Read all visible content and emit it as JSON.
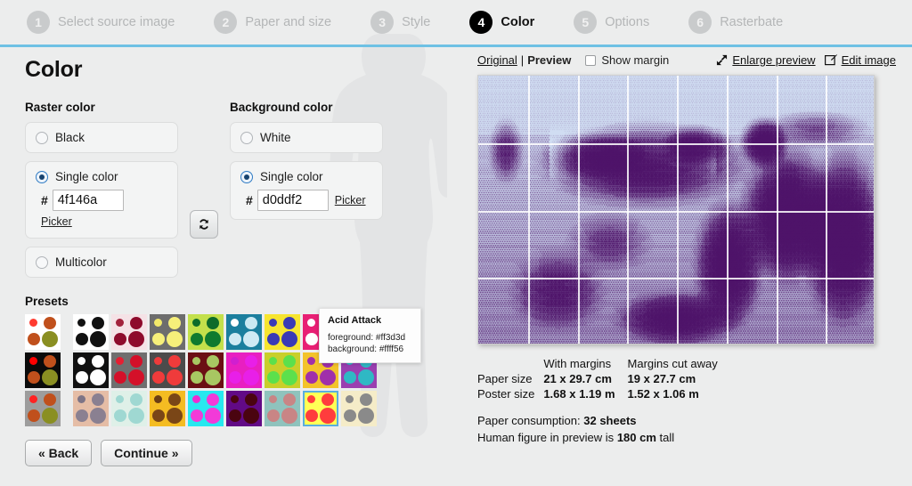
{
  "stepper": {
    "steps": [
      {
        "num": "1",
        "label": "Select source image",
        "active": false
      },
      {
        "num": "2",
        "label": "Paper and size",
        "active": false
      },
      {
        "num": "3",
        "label": "Style",
        "active": false
      },
      {
        "num": "4",
        "label": "Color",
        "active": true
      },
      {
        "num": "5",
        "label": "Options",
        "active": false
      },
      {
        "num": "6",
        "label": "Rasterbate",
        "active": false
      }
    ]
  },
  "page": {
    "title": "Color"
  },
  "raster_color": {
    "group_label": "Raster color",
    "black_label": "Black",
    "black_selected": false,
    "single_label": "Single color",
    "single_selected": true,
    "hash": "#",
    "hex_value": "4f146a",
    "picker_label": "Picker",
    "multicolor_label": "Multicolor",
    "multicolor_selected": false
  },
  "background_color": {
    "group_label": "Background color",
    "white_label": "White",
    "white_selected": false,
    "single_label": "Single color",
    "single_selected": true,
    "hash": "#",
    "hex_value": "d0ddf2",
    "picker_label": "Picker"
  },
  "swap_button": {
    "icon": "swap-colors-icon"
  },
  "presets": {
    "title": "Presets",
    "first_column": [
      {
        "bg": "#ffffff",
        "c1": "#ff3b30",
        "c2": "#c0501c",
        "c3": "#c0501c",
        "c4": "#8a8f22"
      },
      {
        "bg": "#0b0b0b",
        "c1": "#ff0000",
        "c2": "#c0501c",
        "c3": "#c0501c",
        "c4": "#8a8f22"
      },
      {
        "bg": "#9d9d9d",
        "c1": "#ff2222",
        "c2": "#c0501c",
        "c3": "#c0501c",
        "c4": "#8a8f22"
      }
    ],
    "grid": [
      [
        {
          "bg": "#ffffff",
          "c1": "#111111",
          "c2": "#111111",
          "c3": "#111111",
          "c4": "#111111"
        },
        {
          "bg": "#f5e2e6",
          "c1": "#a3223c",
          "c2": "#8e0b2c",
          "c3": "#8e0b2c",
          "c4": "#8e0b2c"
        },
        {
          "bg": "#6d6d6d",
          "c1": "#f2e96a",
          "c2": "#f6ef7a",
          "c3": "#f6ef7a",
          "c4": "#f6ef7a"
        },
        {
          "bg": "#c3e04b",
          "c1": "#0d6b2a",
          "c2": "#0d6b2a",
          "c3": "#0f7a2f",
          "c4": "#0f7a2f"
        },
        {
          "bg": "#1b7f9e",
          "c1": "#ffffff",
          "c2": "#c9e9f3",
          "c3": "#cfeaf4",
          "c4": "#cfeaf4"
        },
        {
          "bg": "#f7e52f",
          "c1": "#3a3ab5",
          "c2": "#3a3ab5",
          "c3": "#3a3ab5",
          "c4": "#3a3ab5"
        },
        {
          "bg": "#e81f74",
          "c1": "#ffffff",
          "c2": "#ffffff",
          "c3": "#ffffff",
          "c4": "#ffffff"
        },
        {
          "bg": "#cdd6ee",
          "c1": "#6a3f9e",
          "c2": "#6a2f9e",
          "c3": "#6a2f9e",
          "c4": "#6a2f9e"
        }
      ],
      [
        {
          "bg": "#111111",
          "c1": "#ffffff",
          "c2": "#ffffff",
          "c3": "#ffffff",
          "c4": "#ffffff"
        },
        {
          "bg": "#6f6f6f",
          "c1": "#e51f32",
          "c2": "#d41029",
          "c3": "#d41029",
          "c4": "#d41029"
        },
        {
          "bg": "#4b4b4b",
          "c1": "#ef3b3b",
          "c2": "#ef3b3b",
          "c3": "#ef3b3b",
          "c4": "#ef3b3b"
        },
        {
          "bg": "#6b0f14",
          "c1": "#a8c762",
          "c2": "#a8c762",
          "c3": "#a8c762",
          "c4": "#a8c762"
        },
        {
          "bg": "#e81fc1",
          "c1": "#d01fd0",
          "c2": "#e81fe8",
          "c3": "#e81fe8",
          "c4": "#e81fe8"
        },
        {
          "bg": "#c9cf2a",
          "c1": "#5ce04c",
          "c2": "#5ce04c",
          "c3": "#5ce04c",
          "c4": "#5ce04c"
        },
        {
          "bg": "#f3c32a",
          "c1": "#a02faa",
          "c2": "#a02faa",
          "c3": "#a02faa",
          "c4": "#a02faa"
        },
        {
          "bg": "#9a3fb0",
          "c1": "#2fb8c4",
          "c2": "#2fb8c4",
          "c3": "#2fb8c4",
          "c4": "#2fb8c4"
        }
      ],
      [
        {
          "bg": "#e5bda6",
          "c1": "#7d7486",
          "c2": "#8a8091",
          "c3": "#8a8091",
          "c4": "#8a8091"
        },
        {
          "bg": "#dff0e8",
          "c1": "#9fd8d2",
          "c2": "#9fd8d2",
          "c3": "#9fd8d2",
          "c4": "#9fd8d2"
        },
        {
          "bg": "#f4bc22",
          "c1": "#6b3d14",
          "c2": "#7a4617",
          "c3": "#7a4617",
          "c4": "#7a4617"
        },
        {
          "bg": "#27e8ef",
          "c1": "#ee2bd2",
          "c2": "#f23ad8",
          "c3": "#f23ad8",
          "c4": "#f23ad8"
        },
        {
          "bg": "#620a86",
          "c1": "#4a0410",
          "c2": "#4a0410",
          "c3": "#4a0410",
          "c4": "#4a0410"
        },
        {
          "bg": "#8fc3bd",
          "c1": "#c98585",
          "c2": "#c98585",
          "c3": "#c98585",
          "c4": "#c98585"
        },
        {
          "bg": "#ffff56",
          "c1": "#ff3d3d",
          "c2": "#ff3d3d",
          "c3": "#ff3d3d",
          "c4": "#ff3d3d",
          "selected": true
        },
        {
          "bg": "#f5ecc8",
          "c1": "#8a8a8a",
          "c2": "#8a8a8a",
          "c3": "#8a8a8a",
          "c4": "#8a8a8a"
        }
      ]
    ],
    "tooltip": {
      "title": "Acid Attack",
      "foreground_line": "foreground: #ff3d3d",
      "background_line": "background: #ffff56"
    }
  },
  "nav": {
    "back_label": "« Back",
    "continue_label": "Continue »"
  },
  "preview_bar": {
    "original_label": "Original",
    "separator": "|",
    "preview_label": "Preview",
    "show_margin_label": "Show margin",
    "show_margin_checked": false,
    "enlarge_label": "Enlarge preview",
    "enlarge_icon": "expand-arrows-icon",
    "edit_label": "Edit image",
    "edit_icon": "pencil-square-icon"
  },
  "preview": {
    "raster_hex": "#4f146a",
    "background_hex": "#d0ddf2",
    "grid_cols": 8,
    "grid_rows": 4
  },
  "info": {
    "col_headers": [
      "",
      "With margins",
      "Margins cut away"
    ],
    "rows": [
      {
        "label": "Paper size",
        "with_margins": "21 x 29.7 cm",
        "cut_away": "19 x 27.7 cm"
      },
      {
        "label": "Poster size",
        "with_margins": "1.68 x 1.19 m",
        "cut_away": "1.52 x 1.06 m"
      }
    ],
    "paper_consumption_label": "Paper consumption:",
    "paper_consumption_value": "32 sheets",
    "human_figure_prefix": "Human figure in preview is",
    "human_figure_value": "180 cm",
    "human_figure_suffix": "tall"
  }
}
